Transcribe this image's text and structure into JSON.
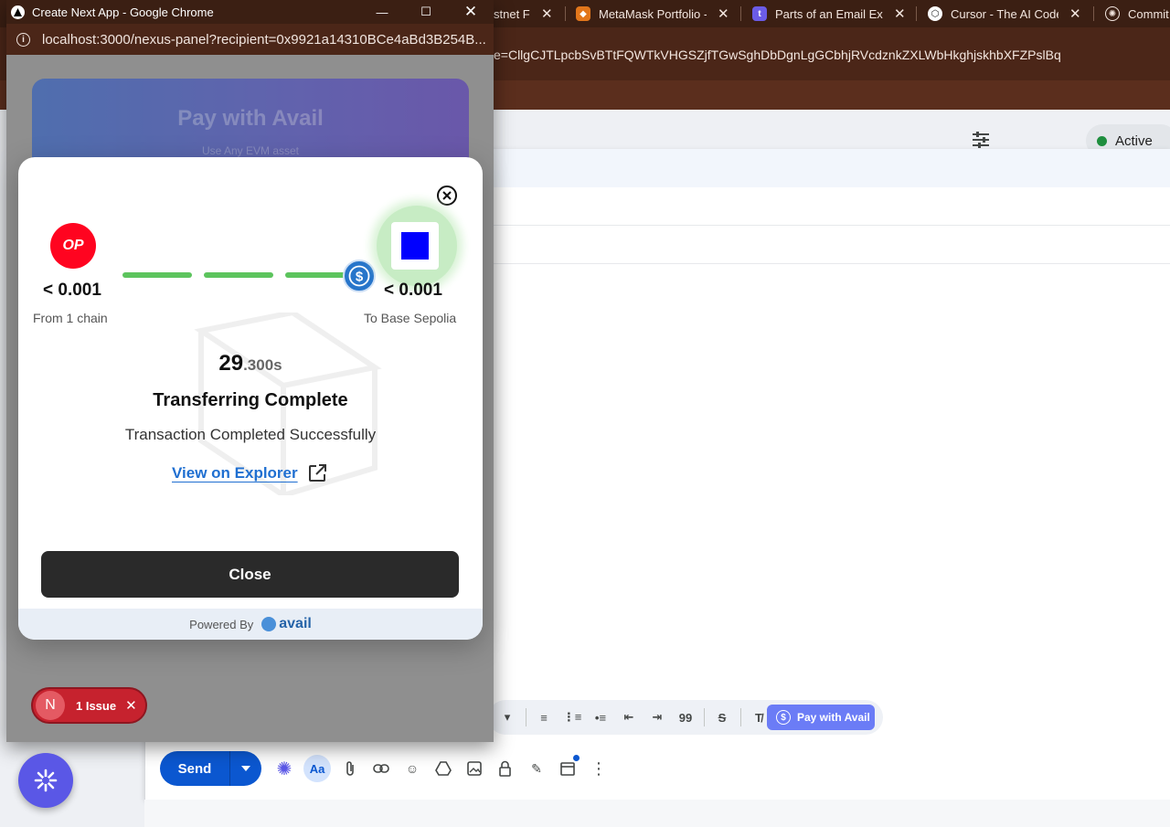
{
  "browser": {
    "tabs": [
      {
        "label": "stnet Fa",
        "icon": "faucet-icon"
      },
      {
        "label": "MetaMask Portfolio -",
        "icon": "metamask-icon"
      },
      {
        "label": "Parts of an Email Exp",
        "icon": "t-icon"
      },
      {
        "label": "Cursor - The AI Code",
        "icon": "cursor-icon"
      },
      {
        "label": "Commit",
        "icon": "openai-icon"
      }
    ],
    "url_fragment": "e=CllgCJTLpcbSvBTtFQWTkVHGSZjfTGwSghDbDgnLgGCbhjRVcdznkZXLWbHkghjskhbXFZPslBq"
  },
  "gmail": {
    "status": "Active",
    "pay_with_avail": "Pay with Avail",
    "send_label": "Send",
    "quote_label": "99",
    "font_toggle": "Aa"
  },
  "popup": {
    "window_title": "Create Next App - Google Chrome",
    "url": "localhost:3000/nexus-panel?recipient=0x9921a14310BCe4aBd3B254B...",
    "pay_button_title": "Pay with Avail",
    "pay_button_sub": "Use Any EVM asset",
    "modal": {
      "source_badge": "OP",
      "source_amount": "< 0.001",
      "source_label": "From 1 chain",
      "dest_amount": "< 0.001",
      "dest_label": "To Base Sepolia",
      "timer_whole": "29",
      "timer_fraction": ".300s",
      "status_title": "Transferring Complete",
      "status_sub": "Transaction Completed Successfully",
      "explorer_link": "View on Explorer",
      "close_label": "Close",
      "powered_by": "Powered By",
      "brand": "avail"
    },
    "issue": {
      "avatar_letter": "N",
      "label": "1 Issue"
    }
  },
  "colors": {
    "op_red": "#ff0420",
    "progress_green": "#5cc45d",
    "link_blue": "#1f6fd1",
    "issue_red": "#c6222e",
    "spark_purple": "#5a57e6",
    "gmail_blue": "#0b57d0"
  }
}
